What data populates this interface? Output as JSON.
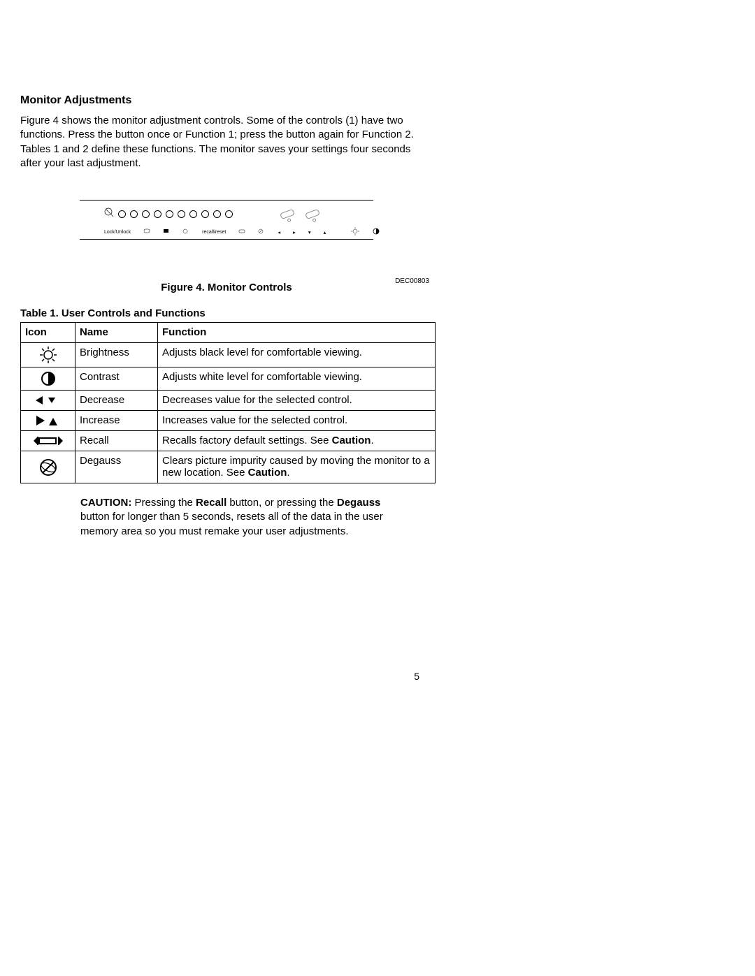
{
  "section_title": "Monitor Adjustments",
  "intro": "Figure 4 shows the monitor adjustment controls. Some of the controls (1) have two functions. Press the button once or Function 1; press the button again for Function 2. Tables 1 and 2 define these functions. The monitor saves your settings four seconds after your last adjustment.",
  "figure": {
    "code": "DEC00803",
    "caption": "Figure 4. Monitor Controls"
  },
  "table": {
    "title": "Table 1.  User Controls and Functions",
    "headers": {
      "icon": "Icon",
      "name": "Name",
      "function": "Function"
    },
    "rows": [
      {
        "icon": "brightness",
        "name": "Brightness",
        "function_html": "Adjusts black level for comfortable viewing."
      },
      {
        "icon": "contrast",
        "name": "Contrast",
        "function_html": "Adjusts white level for comfortable viewing."
      },
      {
        "icon": "decrease",
        "name": "Decrease",
        "function_html": "Decreases value for the selected control."
      },
      {
        "icon": "increase",
        "name": "Increase",
        "function_html": "Increases value for the selected control."
      },
      {
        "icon": "recall",
        "name": "Recall",
        "function_html": "Recalls factory default settings. See <b>Caution</b>."
      },
      {
        "icon": "degauss",
        "name": "Degauss",
        "function_html": "Clears picture impurity caused by moving the monitor to a new location. See <b>Caution</b>."
      }
    ]
  },
  "caution_html": "<span class='bold'>CAUTION:</span> Pressing the <span class='bold'>Recall</span> button, or pressing the <span class='bold'>Degauss</span> button for longer than 5 seconds, resets all of the data in the user memory area so you must remake your user adjustments.",
  "page_number": "5",
  "panel_labels": {
    "lock": "Lock/Unlock",
    "label_tiny": "recall/reset"
  }
}
